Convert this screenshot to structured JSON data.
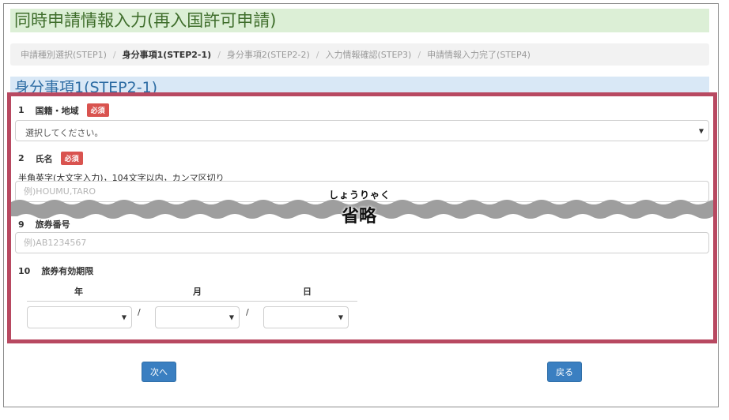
{
  "page": {
    "title": "同時申請情報入力(再入国許可申請)",
    "section_title": "身分事項1(STEP2-1)"
  },
  "breadcrumb": [
    {
      "label": "申請種別選択(STEP1)",
      "active": false
    },
    {
      "label": "身分事項1(STEP2-1)",
      "active": true
    },
    {
      "label": "身分事項2(STEP2-2)",
      "active": false
    },
    {
      "label": "入力情報確認(STEP3)",
      "active": false
    },
    {
      "label": "申請情報入力完了(STEP4)",
      "active": false
    }
  ],
  "form": {
    "required_badge": "必須",
    "nationality": {
      "num": "1",
      "label": "国籍・地域",
      "selected": "選択してください。"
    },
    "name": {
      "num": "2",
      "label": "氏名",
      "note": "半角英字(大文字入力)，104文字以内，カンマ区切り",
      "placeholder": "例)HOUMU,TARO"
    },
    "passport_no": {
      "num": "9",
      "label": "旅券番号",
      "placeholder": "例)AB1234567"
    },
    "passport_expiry": {
      "num": "10",
      "label": "旅券有効期限",
      "year_label": "年",
      "month_label": "月",
      "day_label": "日",
      "separator": "/"
    }
  },
  "omission": {
    "ruby": "しょうりゃく",
    "text": "省略"
  },
  "buttons": {
    "next": "次へ",
    "back": "戻る"
  },
  "colors": {
    "title_bg": "#dcefd6",
    "title_text": "#3f6e2c",
    "highlight_border": "#b84961",
    "badge": "#d9534f",
    "button": "#3a7fc1",
    "section_bg": "#d9e8f6"
  }
}
